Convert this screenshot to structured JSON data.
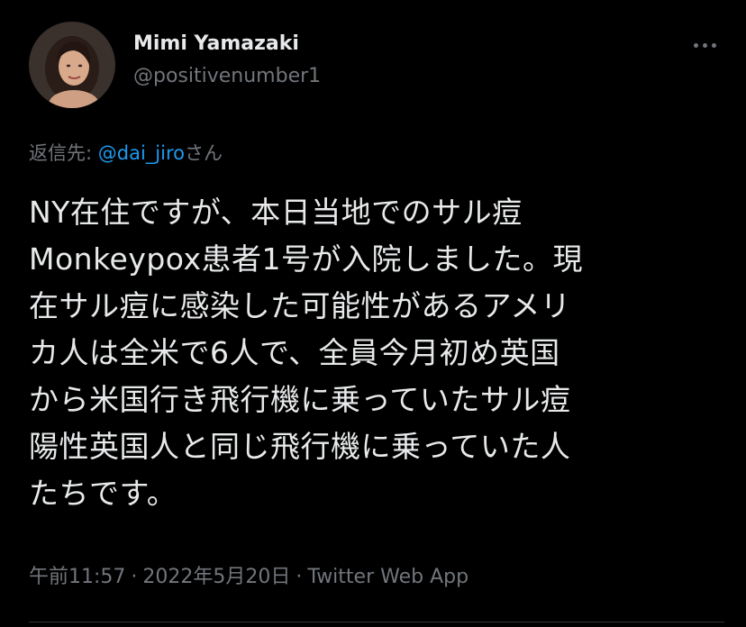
{
  "author": {
    "name": "Mimi Yamazaki",
    "handle": "@positivenumber1",
    "avatar_icon": "profile-photo"
  },
  "reply": {
    "prefix": "返信先: ",
    "mention": "@dai_jiro",
    "suffix": "さん"
  },
  "tweet": {
    "lines": [
      "NY在住ですが、本日当地でのサル痘",
      "Monkeypox患者1号が入院しました。現",
      "在サル痘に感染した可能性があるアメリ",
      "カ人は全米で6人で、全員今月初め英国",
      "から米国行き飛行機に乗っていたサル痘",
      "陽性英国人と同じ飛行機に乗っていた人",
      "たちです。"
    ]
  },
  "meta": {
    "time": "午前11:57",
    "date": "2022年5月20日",
    "source": "Twitter Web App",
    "separator": "·"
  },
  "colors": {
    "background": "#000000",
    "text": "#e7e9ea",
    "secondary": "#71767b",
    "link": "#1d9bf0"
  }
}
